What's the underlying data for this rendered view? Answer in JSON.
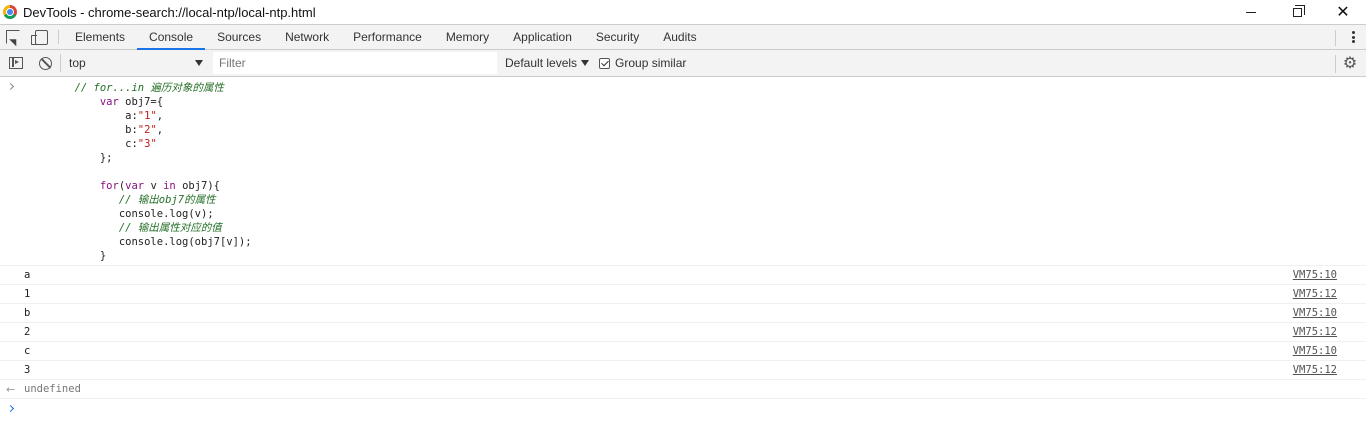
{
  "window": {
    "title": "DevTools - chrome-search://local-ntp/local-ntp.html",
    "minimize_label": "",
    "close_glyph": "✕"
  },
  "tabs": [
    {
      "label": "Elements",
      "active": false
    },
    {
      "label": "Console",
      "active": true
    },
    {
      "label": "Sources",
      "active": false
    },
    {
      "label": "Network",
      "active": false
    },
    {
      "label": "Performance",
      "active": false
    },
    {
      "label": "Memory",
      "active": false
    },
    {
      "label": "Application",
      "active": false
    },
    {
      "label": "Security",
      "active": false
    },
    {
      "label": "Audits",
      "active": false
    }
  ],
  "toolbar": {
    "context": "top",
    "filter_placeholder": "Filter",
    "levels_label": "Default levels",
    "group_similar_label": "Group similar",
    "group_similar_checked": true,
    "gear_glyph": "⚙"
  },
  "console": {
    "code": [
      [
        {
          "t": "        ",
          "c": ""
        },
        {
          "t": "// for...in 遍历对象的属性",
          "c": "cm"
        }
      ],
      [
        {
          "t": "            ",
          "c": ""
        },
        {
          "t": "var",
          "c": "kw"
        },
        {
          "t": " obj7={",
          "c": ""
        }
      ],
      [
        {
          "t": "                a:",
          "c": ""
        },
        {
          "t": "\"1\"",
          "c": "str"
        },
        {
          "t": ",",
          "c": ""
        }
      ],
      [
        {
          "t": "                b:",
          "c": ""
        },
        {
          "t": "\"2\"",
          "c": "str"
        },
        {
          "t": ",",
          "c": ""
        }
      ],
      [
        {
          "t": "                c:",
          "c": ""
        },
        {
          "t": "\"3\"",
          "c": "str"
        }
      ],
      [
        {
          "t": "            };",
          "c": ""
        }
      ],
      [
        {
          "t": "",
          "c": ""
        }
      ],
      [
        {
          "t": "            ",
          "c": ""
        },
        {
          "t": "for",
          "c": "kw"
        },
        {
          "t": "(",
          "c": ""
        },
        {
          "t": "var",
          "c": "kw"
        },
        {
          "t": " v ",
          "c": ""
        },
        {
          "t": "in",
          "c": "kw"
        },
        {
          "t": " obj7){",
          "c": ""
        }
      ],
      [
        {
          "t": "               ",
          "c": ""
        },
        {
          "t": "// 输出obj7的属性",
          "c": "cm"
        }
      ],
      [
        {
          "t": "               console.log(v);",
          "c": ""
        }
      ],
      [
        {
          "t": "               ",
          "c": ""
        },
        {
          "t": "// 输出属性对应的值",
          "c": "cm"
        }
      ],
      [
        {
          "t": "               console.log(obj7[v]);",
          "c": ""
        }
      ],
      [
        {
          "t": "            }",
          "c": ""
        }
      ]
    ],
    "logs": [
      {
        "value": "a",
        "source": "VM75:10"
      },
      {
        "value": "1",
        "source": "VM75:12"
      },
      {
        "value": "b",
        "source": "VM75:10"
      },
      {
        "value": "2",
        "source": "VM75:12"
      },
      {
        "value": "c",
        "source": "VM75:10"
      },
      {
        "value": "3",
        "source": "VM75:12"
      }
    ],
    "result": "undefined",
    "result_arrow": "←"
  },
  "colors": {
    "accent": "#1a73e8",
    "comment": "#236e25",
    "keyword": "#881280",
    "string": "#c41a16"
  }
}
